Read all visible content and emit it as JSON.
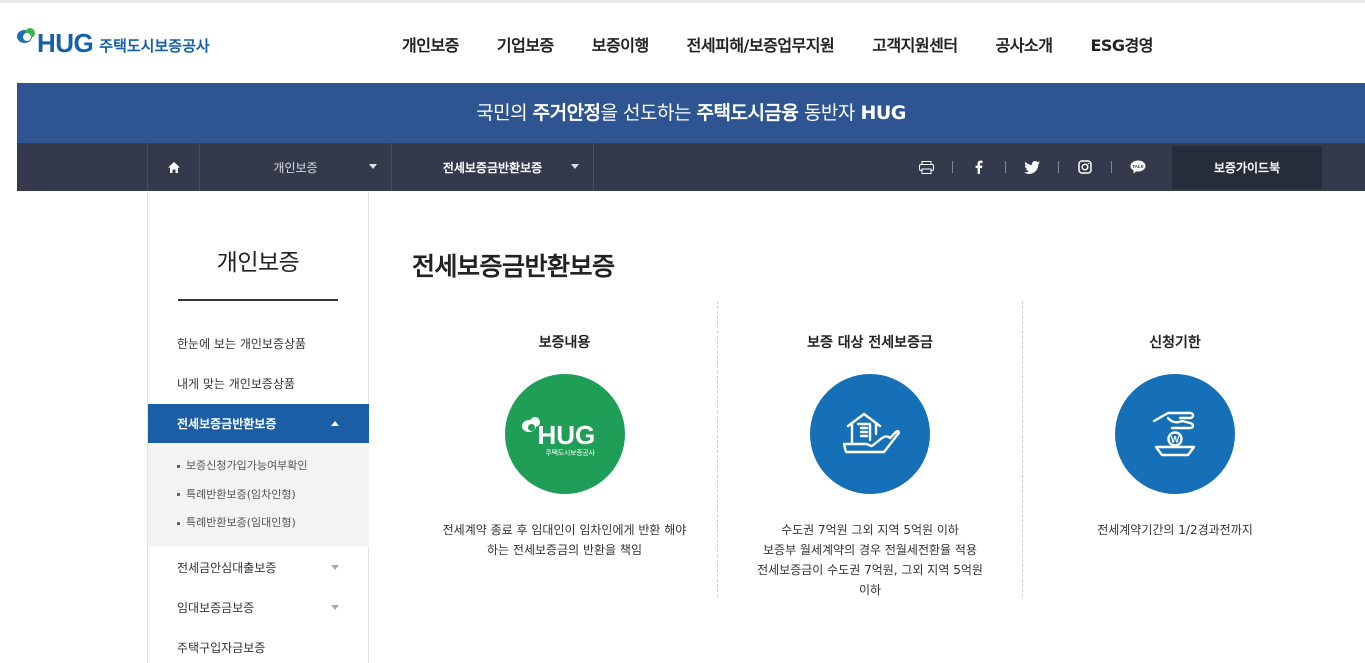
{
  "header": {
    "logo_text": "HUG",
    "logo_sub": "주택도시보증공사",
    "nav": [
      "개인보증",
      "기업보증",
      "보증이행",
      "전세피해/보증업무지원",
      "고객지원센터",
      "공사소개",
      "ESG경영"
    ]
  },
  "banner": {
    "pre": "국민의 ",
    "b1": "주거안정",
    "mid": "을 선도하는 ",
    "b2": "주택도시금융",
    "post": " 동반자 ",
    "b3": "HUG"
  },
  "locbar": {
    "level1": "개인보증",
    "level2": "전세보증금반환보증",
    "guide": "보증가이드북"
  },
  "sidebar": {
    "title": "개인보증",
    "items": [
      "한눈에 보는 개인보증상품",
      "내게 맞는 개인보증상품",
      "전세보증금반환보증"
    ],
    "sub": [
      "보증신청가입가능여부확인",
      "특례반환보증(임차인형)",
      "특례반환보증(임대인형)"
    ],
    "more": [
      "전세금안심대출보증",
      "임대보증금보증",
      "주택구입자금보증"
    ]
  },
  "content": {
    "title": "전세보증금반환보증",
    "columns": [
      {
        "title": "보증내용",
        "logo_text": "HUG",
        "logo_sub": "주택도시보증공사",
        "desc": [
          "전세계약 종료 후 임대인이 임차인에게 반환 해야",
          "하는 전세보증금의 반환을 책임"
        ]
      },
      {
        "title": "보증 대상 전세보증금",
        "desc": [
          "수도권 7억원 그외 지역 5억원 이하",
          "보증부 월세계약의 경우 전월세전환율 적용",
          "전세보증금이 수도권 7억원, 그외 지역 5억원",
          "이하"
        ]
      },
      {
        "title": "신청기한",
        "desc": [
          "전세계약기간의 1/2경과전까지"
        ]
      }
    ]
  }
}
